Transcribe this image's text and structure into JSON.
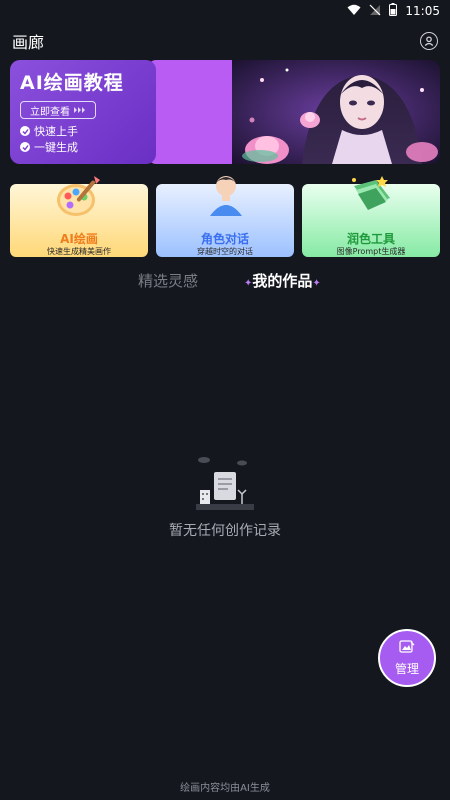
{
  "status_bar": {
    "time": "11:05"
  },
  "header": {
    "title": "画廊"
  },
  "banner": {
    "title": "AI绘画教程",
    "cta_label": "立即查看",
    "bullets": [
      "快速上手",
      "一键生成"
    ]
  },
  "cards": [
    {
      "title": "AI绘画",
      "subtitle": "快速生成精美画作",
      "title_color": "#f07d1c"
    },
    {
      "title": "角色对话",
      "subtitle": "穿越时空的对话",
      "title_color": "#3a6ff0"
    },
    {
      "title": "润色工具",
      "subtitle": "图像Prompt生成器",
      "title_color": "#1f9a3a"
    }
  ],
  "tabs": [
    {
      "label": "精选灵感",
      "active": false
    },
    {
      "label": "我的作品",
      "active": true
    }
  ],
  "empty_state": {
    "message": "暂无任何创作记录"
  },
  "fab": {
    "label": "管理"
  },
  "footer": {
    "note": "绘画内容均由AI生成"
  },
  "colors": {
    "background": "#15171f",
    "accent": "#a65cf0"
  }
}
